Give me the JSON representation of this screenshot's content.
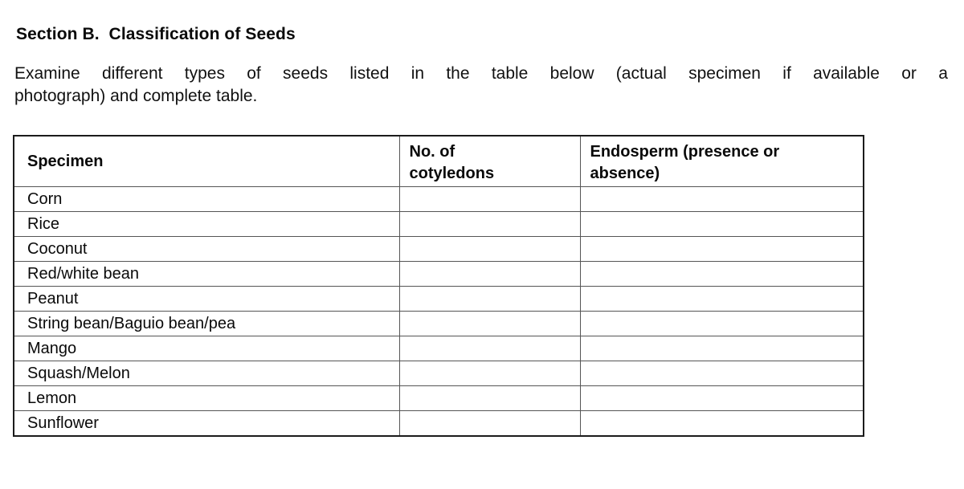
{
  "document": {
    "heading": "Section B.  Classification of Seeds",
    "intro": {
      "line1_words": [
        "Examine",
        "different",
        "types",
        "of",
        "seeds",
        "listed",
        "in",
        "the",
        "table",
        "below",
        "(actual",
        "specimen",
        "if",
        "available",
        "or",
        "a"
      ],
      "line2": "photograph) and complete table."
    },
    "table": {
      "headers": {
        "specimen": "Specimen",
        "cotyledons": "No. of\ncotyledons",
        "endosperm": "Endosperm (presence or\nabsence)"
      },
      "rows": [
        {
          "specimen": "Corn",
          "cotyledons": "",
          "endosperm": ""
        },
        {
          "specimen": "Rice",
          "cotyledons": "",
          "endosperm": ""
        },
        {
          "specimen": "Coconut",
          "cotyledons": "",
          "endosperm": ""
        },
        {
          "specimen": "Red/white bean",
          "cotyledons": "",
          "endosperm": ""
        },
        {
          "specimen": "Peanut",
          "cotyledons": "",
          "endosperm": ""
        },
        {
          "specimen": "String bean/Baguio bean/pea",
          "cotyledons": "",
          "endosperm": ""
        },
        {
          "specimen": "Mango",
          "cotyledons": "",
          "endosperm": ""
        },
        {
          "specimen": "Squash/Melon",
          "cotyledons": "",
          "endosperm": ""
        },
        {
          "specimen": "Lemon",
          "cotyledons": "",
          "endosperm": ""
        },
        {
          "specimen": "Sunflower",
          "cotyledons": "",
          "endosperm": ""
        }
      ]
    },
    "colors": {
      "text": "#0a0a0a",
      "page_background": "#ffffff",
      "table_outer_border": "#1b1b1b",
      "table_inner_border": "#555555"
    }
  }
}
